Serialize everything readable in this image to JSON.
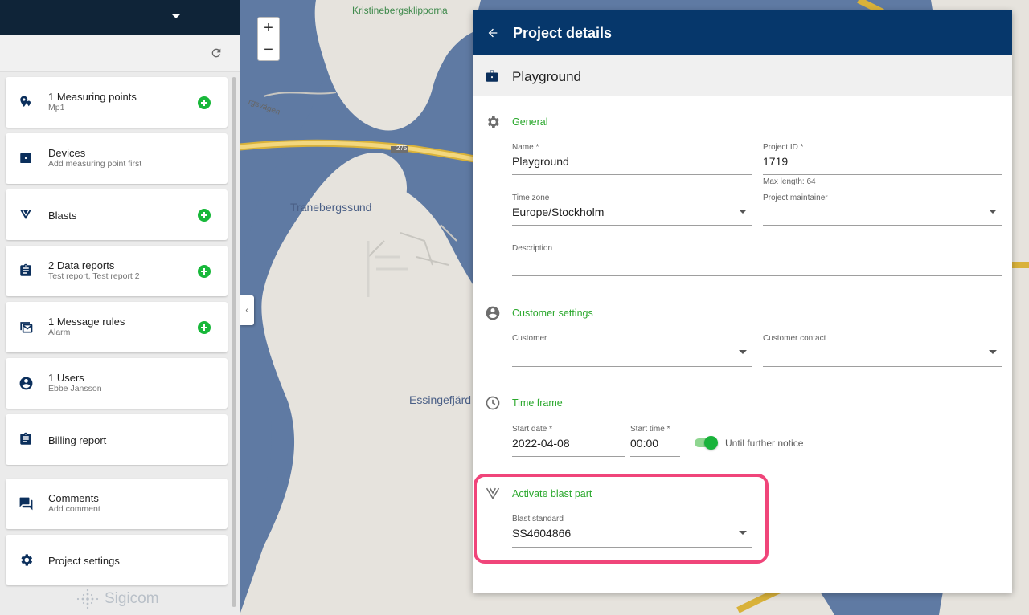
{
  "map": {
    "labels": {
      "top": "Kristinebergsklipporna",
      "sound": "Tranebergssund",
      "fjard": "Essingefjärd",
      "road": "275",
      "street": "rgsvägen"
    },
    "zoom_in": "+",
    "zoom_out": "−",
    "collapse": "‹"
  },
  "sidebar": {
    "items": [
      {
        "title": "1 Measuring points",
        "sub": "Mp1",
        "icon": "location-pin-icon",
        "add": true
      },
      {
        "title": "Devices",
        "sub": "Add measuring point first",
        "icon": "device-icon",
        "add": false
      },
      {
        "title": "Blasts",
        "sub": "",
        "icon": "blast-icon",
        "add": true
      },
      {
        "title": "2 Data reports",
        "sub": "Test report, Test report 2",
        "icon": "clipboard-icon",
        "add": true
      },
      {
        "title": "1 Message rules",
        "sub": "Alarm",
        "icon": "message-rules-icon",
        "add": true
      },
      {
        "title": "1 Users",
        "sub": "Ebbe Jansson",
        "icon": "user-icon",
        "add": false
      },
      {
        "title": "Billing report",
        "sub": "",
        "icon": "billing-icon",
        "add": false
      },
      {
        "title": "Comments",
        "sub": "Add comment",
        "icon": "comment-icon",
        "add": false
      },
      {
        "title": "Project settings",
        "sub": "",
        "icon": "gear-icon",
        "add": false
      }
    ],
    "logo": "Sigicom"
  },
  "dialog": {
    "title": "Project details",
    "project_name": "Playground",
    "general": {
      "title": "General",
      "name_label": "Name *",
      "name_value": "Playground",
      "id_label": "Project ID *",
      "id_value": "1719",
      "id_hint": "Max length: 64",
      "tz_label": "Time zone",
      "tz_value": "Europe/Stockholm",
      "maintainer_label": "Project maintainer",
      "maintainer_value": "",
      "desc_label": "Description",
      "desc_value": ""
    },
    "customer": {
      "title": "Customer settings",
      "customer_label": "Customer",
      "customer_value": "",
      "contact_label": "Customer contact",
      "contact_value": ""
    },
    "timeframe": {
      "title": "Time frame",
      "start_date_label": "Start date *",
      "start_date_value": "2022-04-08",
      "start_time_label": "Start time *",
      "start_time_value": "00:00",
      "toggle_label": "Until further notice",
      "toggle_on": true
    },
    "blast": {
      "title": "Activate blast part",
      "standard_label": "Blast standard",
      "standard_value": "SS4604866"
    }
  },
  "colors": {
    "header": "#06376b",
    "sidebar_top": "#0f2438",
    "accent_green": "#2aa82c",
    "add_green": "#18b83a",
    "highlight": "#f0457a",
    "water": "#5f7aa3"
  }
}
